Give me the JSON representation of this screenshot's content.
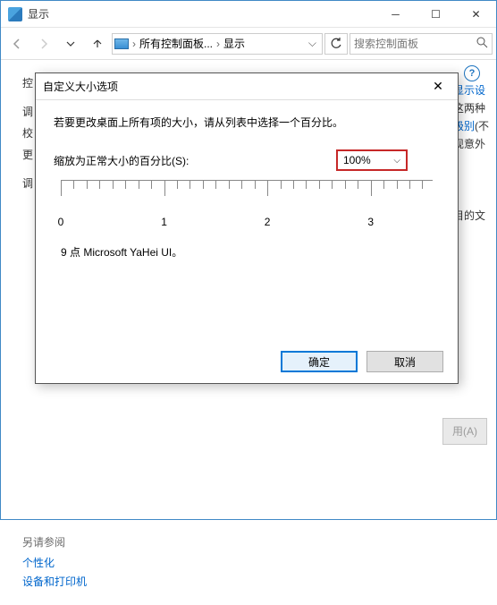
{
  "window": {
    "title": "显示"
  },
  "toolbar": {
    "breadcrumb": {
      "seg1": "所有控制面板...",
      "seg2": "显示"
    },
    "search_placeholder": "搜索控制面板"
  },
  "left": {
    "item1": "控",
    "item2": "调",
    "item3": "校",
    "item4": "更",
    "item5": "调"
  },
  "peek": {
    "line1a": "些显示设",
    "line2": "果这两种",
    "line3a": "放级别",
    "line3b": "(不",
    "line4": "出现意外",
    "line5": "项目的文",
    "apply": "用(A)"
  },
  "seealso": {
    "header": "另请参阅",
    "link1": "个性化",
    "link2": "设备和打印机"
  },
  "dialog": {
    "title": "自定义大小选项",
    "intro": "若要更改桌面上所有项的大小，请从列表中选择一个百分比。",
    "scale_label": "缩放为正常大小的百分比(S):",
    "scale_value": "100%",
    "ruler": {
      "l0": "0",
      "l1": "1",
      "l2": "2",
      "l3": "3"
    },
    "sample": "9 点 Microsoft YaHei UI。",
    "ok": "确定",
    "cancel": "取消"
  }
}
